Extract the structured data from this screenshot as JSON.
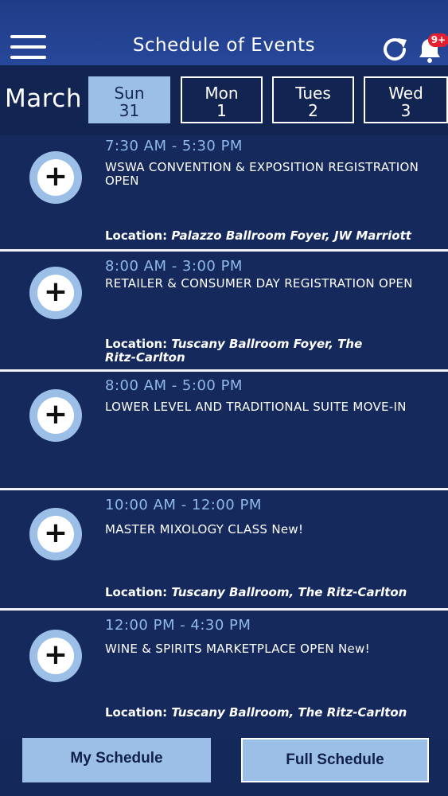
{
  "header": {
    "title": "Schedule of Events",
    "badge": "9+"
  },
  "datebar": {
    "month": "March",
    "days": [
      {
        "name": "Sun",
        "num": "31",
        "active": true
      },
      {
        "name": "Mon",
        "num": "1"
      },
      {
        "name": "Tues",
        "num": "2"
      },
      {
        "name": "Wed",
        "num": "3"
      }
    ]
  },
  "events": [
    {
      "time": "7:30 AM - 5:30 PM",
      "name": "WSWA CONVENTION & EXPOSITION REGISTRATION OPEN",
      "location_label": "Location:",
      "location": "Palazzo Ballroom Foyer, JW Marriott"
    },
    {
      "time": "8:00 AM - 3:00 PM",
      "name": "RETAILER & CONSUMER DAY REGISTRATION OPEN",
      "location_label": "Location:",
      "location": "Tuscany Ballroom Foyer, The Ritz-Carlton"
    },
    {
      "time": "8:00 AM - 5:00 PM",
      "name": "LOWER LEVEL AND TRADITIONAL SUITE MOVE-IN"
    },
    {
      "time": "10:00 AM - 12:00 PM",
      "name": "MASTER MIXOLOGY CLASS New!",
      "location_label": "Location:",
      "location": "Tuscany Ballroom, The Ritz-Carlton"
    },
    {
      "time": "12:00 PM - 4:30 PM",
      "name": "WINE & SPIRITS MARKETPLACE OPEN New!",
      "location_label": "Location:",
      "location": "Tuscany Ballroom, The Ritz-Carlton"
    }
  ],
  "footer": {
    "my_schedule": "My Schedule",
    "full_schedule": "Full Schedule"
  }
}
